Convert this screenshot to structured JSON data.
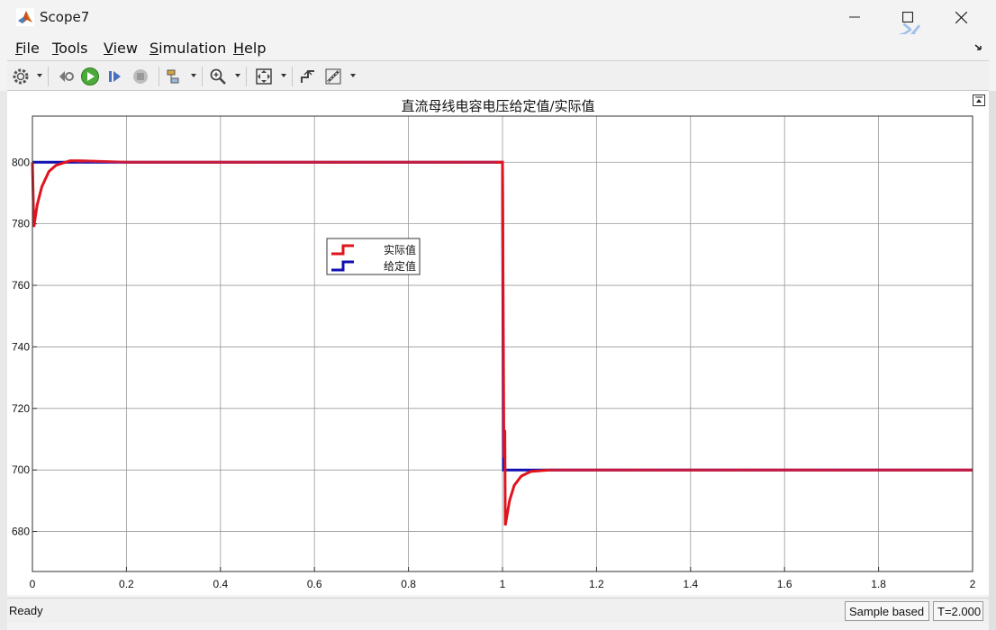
{
  "window": {
    "title": "Scope7"
  },
  "menu": [
    {
      "label": "File",
      "key": "F",
      "rest": "ile"
    },
    {
      "label": "Tools",
      "key": "T",
      "rest": "ools"
    },
    {
      "label": "View",
      "key": "V",
      "rest": "iew"
    },
    {
      "label": "Simulation",
      "key": "S",
      "rest": "imulation"
    },
    {
      "label": "Help",
      "key": "H",
      "rest": "elp"
    }
  ],
  "toolbar": {
    "icons": [
      "settings-icon",
      "step-back-icon",
      "run-icon",
      "step-forward-icon",
      "stop-icon",
      "highlight-icon",
      "zoom-icon",
      "autoscale-icon",
      "triggers-icon",
      "measurements-icon"
    ]
  },
  "watermark": "水印",
  "status": {
    "ready": "Ready",
    "sample": "Sample based",
    "time": "T=2.000"
  },
  "colors": {
    "actual": "#e0141e",
    "reference": "#1010b0",
    "grid": "#9a9a9a"
  },
  "chart_data": {
    "type": "line",
    "title": "直流母线电容电压给定值/实际值",
    "xlabel": "",
    "ylabel": "",
    "xlim": [
      0,
      2
    ],
    "ylim": [
      667,
      815
    ],
    "xticks": [
      "0",
      "0.2",
      "0.4",
      "0.6",
      "0.8",
      "1",
      "1.2",
      "1.4",
      "1.6",
      "1.8",
      "2"
    ],
    "yticks": [
      "680",
      "700",
      "720",
      "740",
      "760",
      "780",
      "800"
    ],
    "grid": true,
    "legend_position": "upper-left-center",
    "series": [
      {
        "name": "实际值",
        "color": "#e0141e",
        "points": [
          [
            0,
            800
          ],
          [
            0.003,
            779
          ],
          [
            0.01,
            786
          ],
          [
            0.02,
            792
          ],
          [
            0.035,
            797
          ],
          [
            0.05,
            799
          ],
          [
            0.08,
            800.5
          ],
          [
            0.1,
            800.5
          ],
          [
            0.2,
            800
          ],
          [
            0.5,
            800
          ],
          [
            0.8,
            800
          ],
          [
            0.99,
            800
          ],
          [
            1.0,
            800
          ],
          [
            1.003,
            704
          ],
          [
            1.005,
            713
          ],
          [
            1.006,
            682
          ],
          [
            1.015,
            690
          ],
          [
            1.025,
            695
          ],
          [
            1.04,
            698
          ],
          [
            1.06,
            699.5
          ],
          [
            1.1,
            700
          ],
          [
            1.5,
            700
          ],
          [
            2.0,
            700
          ]
        ]
      },
      {
        "name": "给定值",
        "color": "#1010b0",
        "points": [
          [
            0,
            800
          ],
          [
            1.0,
            800
          ],
          [
            1.002,
            700
          ],
          [
            2.0,
            700
          ]
        ]
      }
    ]
  }
}
